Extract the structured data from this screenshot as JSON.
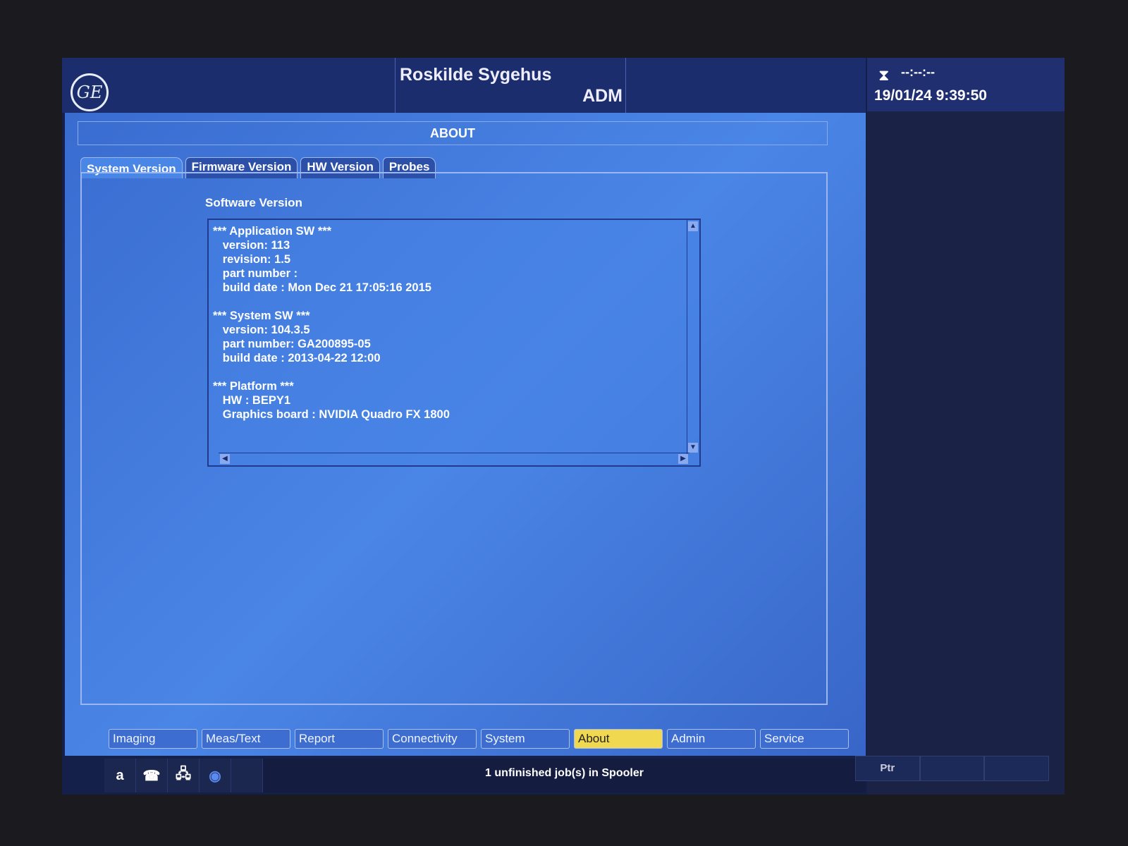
{
  "header": {
    "logo": "GE",
    "hospital": "Roskilde Sygehus",
    "user": "ADM"
  },
  "status_panel": {
    "timer": "--:--:--",
    "datetime": "19/01/24 9:39:50",
    "icon": "hourglass-icon"
  },
  "dialog": {
    "title": "ABOUT",
    "tabs": [
      {
        "label": "System Version",
        "active": true
      },
      {
        "label": "Firmware Version"
      },
      {
        "label": "HW Version"
      },
      {
        "label": "Probes"
      }
    ],
    "section_label": "Software Version",
    "lines": [
      "*** Application SW ***",
      "   version: 113",
      "   revision: 1.5",
      "   part number :",
      "   build date : Mon Dec 21 17:05:16 2015",
      "",
      "*** System SW ***",
      "   version: 104.3.5",
      "   part number: GA200895-05",
      "   build date : 2013-04-22 12:00",
      "",
      "*** Platform ***",
      "   HW : BEPY1",
      "   Graphics board : NVIDIA Quadro FX 1800"
    ]
  },
  "nav": [
    {
      "label": "Imaging"
    },
    {
      "label": "Meas/Text"
    },
    {
      "label": "Report"
    },
    {
      "label": "Connectivity"
    },
    {
      "label": "System"
    },
    {
      "label": "About",
      "active": true
    },
    {
      "label": "Admin"
    },
    {
      "label": "Service"
    }
  ],
  "statusbar": {
    "icons": [
      "a",
      "phone-icon",
      "network-icon",
      "disc-icon"
    ],
    "message": "1 unfinished job(s) in Spooler",
    "ptr": "Ptr"
  }
}
